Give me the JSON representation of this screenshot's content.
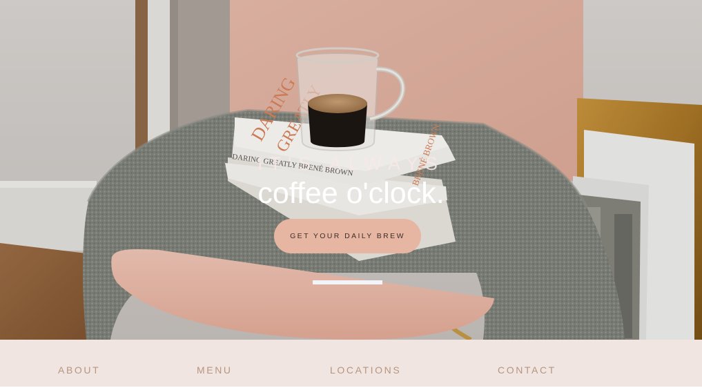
{
  "hero": {
    "tagline": "IT'S ALWAYS",
    "headline": "coffee o'clock.",
    "cta_label": "GET YOUR DAILY BREW",
    "photo": {
      "book_title_a": "DARING",
      "book_title_b": "GREATLY",
      "book_spine": "DARING GREATLY  BRENÉ BROWN",
      "book_spine_b": "BRENÉ BROWN"
    }
  },
  "nav": {
    "items": [
      {
        "label": "ABOUT"
      },
      {
        "label": "MENU"
      },
      {
        "label": "LOCATIONS"
      },
      {
        "label": "CONTACT"
      }
    ]
  },
  "colors": {
    "cta_background": "#e7b6a3",
    "nav_background": "#f1e5e2",
    "nav_text": "#b6957f",
    "headline_text": "#ffffff"
  }
}
